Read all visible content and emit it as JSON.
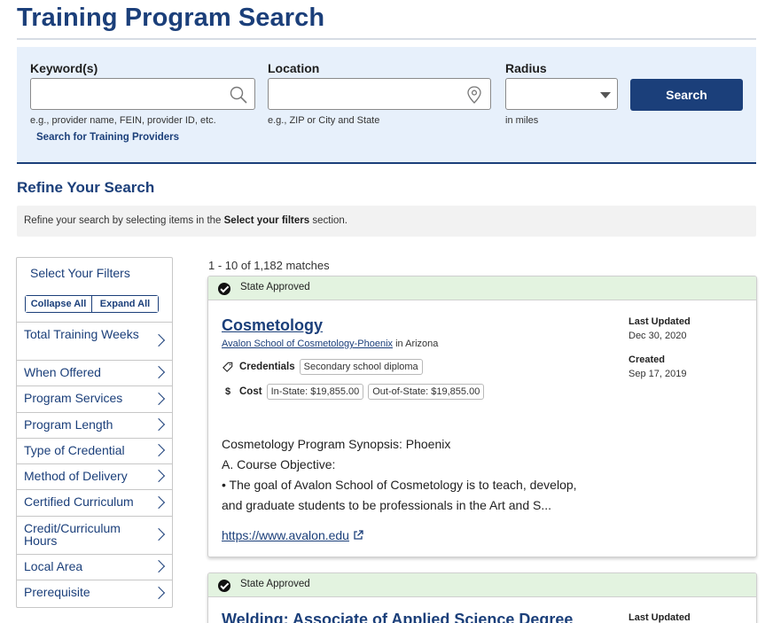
{
  "page": {
    "title": "Training Program Search"
  },
  "search": {
    "keyword_label": "Keyword(s)",
    "keyword_value": "",
    "keyword_hint": "e.g., provider name, FEIN, provider ID, etc.",
    "provider_link": "Search for Training Providers",
    "location_label": "Location",
    "location_value": "",
    "location_hint": "e.g., ZIP or City and State",
    "radius_label": "Radius",
    "radius_value": "",
    "radius_hint": "in miles",
    "search_button": "Search"
  },
  "refine": {
    "title": "Refine Your Search",
    "text_before": "Refine your search by selecting items in the ",
    "text_bold": "Select your filters",
    "text_after": " section."
  },
  "filters": {
    "title": "Select Your Filters",
    "collapse_all": "Collapse All",
    "expand_all": "Expand All",
    "items": [
      "Total Training Weeks",
      "When Offered",
      "Program Services",
      "Program Length",
      "Type of Credential",
      "Method of Delivery",
      "Certified Curriculum",
      "Credit/Curriculum Hours",
      "Local Area",
      "Prerequisite"
    ]
  },
  "results": {
    "count_text": "1 - 10 of 1,182 matches",
    "items": [
      {
        "status": "State Approved",
        "title": "Cosmetology",
        "school": "Avalon School of Cosmetology-Phoenix",
        "location": "in Arizona",
        "credentials_label": "Credentials",
        "credential": "Secondary school diploma",
        "cost_label": "Cost",
        "cost_in_state": "In-State: $19,855.00",
        "cost_out_state": "Out-of-State: $19,855.00",
        "last_updated_label": "Last Updated",
        "last_updated": "Dec 30, 2020",
        "created_label": "Created",
        "created": "Sep 17, 2019",
        "synopsis": [
          "Cosmetology Program Synopsis: Phoenix",
          "A. Course Objective:",
          "• The goal of Avalon School of Cosmetology is to teach, develop,",
          "and graduate students to be professionals in the Art and S..."
        ],
        "url": "https://www.avalon.edu"
      },
      {
        "status": "State Approved",
        "title": "Welding: Associate of Applied Science Degree",
        "last_updated_label": "Last Updated"
      }
    ]
  },
  "icons": {
    "keyword": "search-icon",
    "location": "map-pin-icon",
    "radius": "chevron-down-icon",
    "credentials": "tag-icon",
    "cost": "dollar-icon",
    "link": "external-link-icon",
    "status": "check-circle-icon"
  },
  "colors": {
    "primary": "#1b3f7a",
    "panel": "#e7f0fb",
    "approved": "#e3f3e0"
  }
}
